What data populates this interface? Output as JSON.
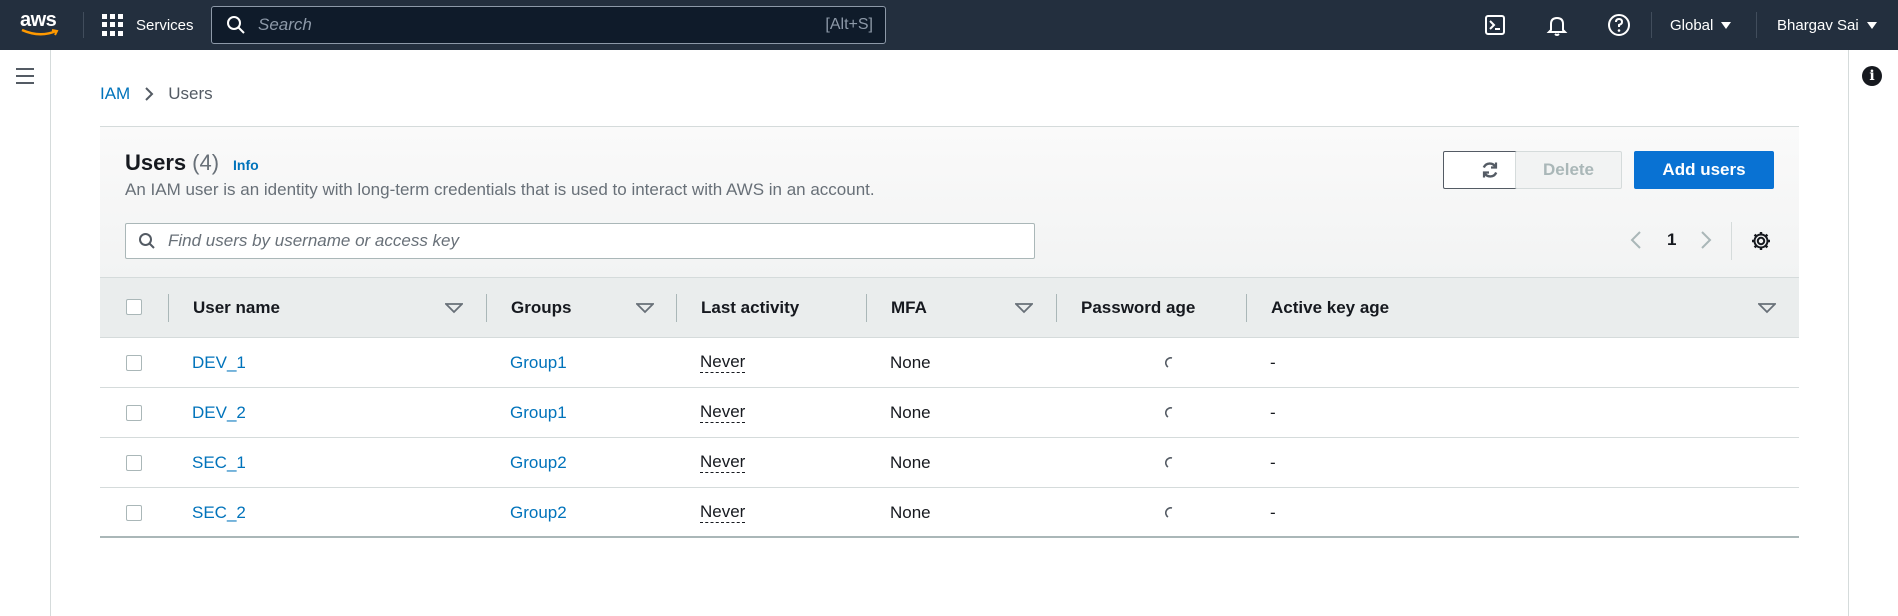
{
  "nav": {
    "logo": "aws",
    "services_label": "Services",
    "search_placeholder": "Search",
    "search_shortcut": "[Alt+S]",
    "region_label": "Global",
    "account_label": "Bhargav Sai",
    "icons": [
      "cloudshell-icon",
      "notifications-icon",
      "help-icon"
    ]
  },
  "breadcrumb": {
    "root": "IAM",
    "current": "Users"
  },
  "page": {
    "title": "Users",
    "count": "(4)",
    "info_label": "Info",
    "description": "An IAM user is an identity with long-term credentials that is used to interact with AWS in an account.",
    "delete_label": "Delete",
    "add_label": "Add users",
    "filter_placeholder": "Find users by username or access key",
    "page_number": "1"
  },
  "table": {
    "columns": [
      "User name",
      "Groups",
      "Last activity",
      "MFA",
      "Password age",
      "Active key age"
    ],
    "rows": [
      {
        "user": "DEV_1",
        "group": "Group1",
        "last_activity": "Never",
        "mfa": "None",
        "key_age": "-"
      },
      {
        "user": "DEV_2",
        "group": "Group1",
        "last_activity": "Never",
        "mfa": "None",
        "key_age": "-"
      },
      {
        "user": "SEC_1",
        "group": "Group2",
        "last_activity": "Never",
        "mfa": "None",
        "key_age": "-"
      },
      {
        "user": "SEC_2",
        "group": "Group2",
        "last_activity": "Never",
        "mfa": "None",
        "key_age": "-"
      }
    ]
  },
  "colors": {
    "nav_bg": "#232f3e",
    "link": "#0073bb",
    "primary": "#0972d3"
  }
}
